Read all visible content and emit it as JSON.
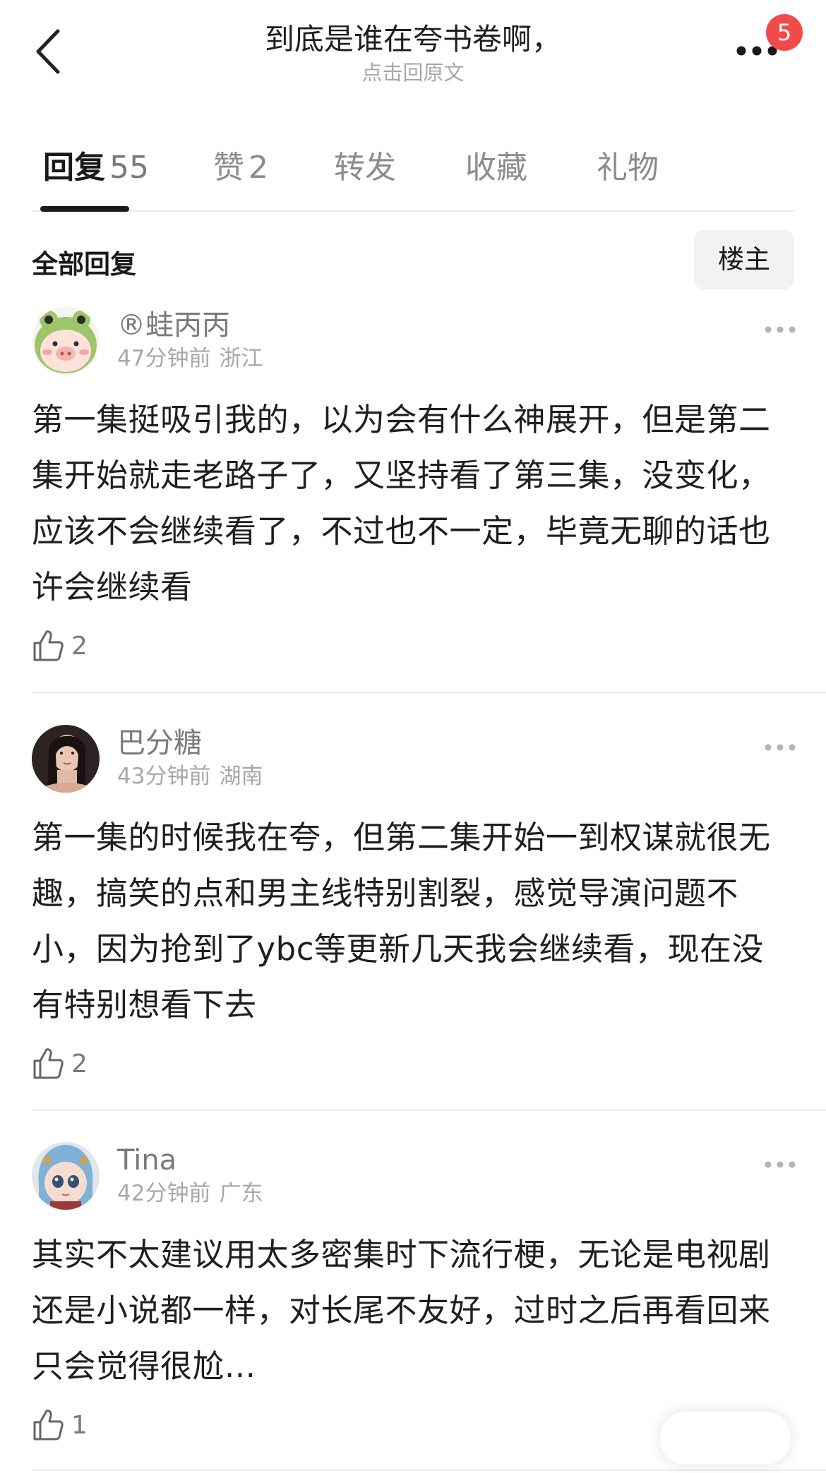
{
  "header": {
    "title": "到底是谁在夸书卷啊，",
    "subtitle": "点击回原文",
    "notification_count": "5"
  },
  "tabs": [
    {
      "label": "回复",
      "count": "55",
      "active": true
    },
    {
      "label": "赞",
      "count": "2",
      "active": false
    },
    {
      "label": "转发",
      "count": "",
      "active": false
    },
    {
      "label": "收藏",
      "count": "",
      "active": false
    },
    {
      "label": "礼物",
      "count": "",
      "active": false
    }
  ],
  "section": {
    "title": "全部回复",
    "filter_label": "楼主"
  },
  "comments": [
    {
      "username": "®蛙丙丙",
      "time": "47分钟前",
      "location": "浙江",
      "text": "第一集挺吸引我的，以为会有什么神展开，但是第二集开始就走老路子了，又坚持看了第三集，没变化，应该不会继续看了，不过也不一定，毕竟无聊的话也许会继续看",
      "likes": "2"
    },
    {
      "username": "巴分糖",
      "time": "43分钟前",
      "location": "湖南",
      "text": "第一集的时候我在夸，但第二集开始一到权谋就很无趣，搞笑的点和男主线特别割裂，感觉导演问题不小，因为抢到了ybc等更新几天我会继续看，现在没有特别想看下去",
      "likes": "2"
    },
    {
      "username": "Tina",
      "time": "42分钟前",
      "location": "广东",
      "text": "其实不太建议用太多密集时下流行梗，无论是电视剧还是小说都一样，对长尾不友好，过时之后再看回来只会觉得很尬...",
      "likes": "1"
    }
  ],
  "colors": {
    "badge": "#f24a4a",
    "text_primary": "#1a1a1a",
    "text_secondary": "#a8a8a8",
    "divider": "#ececec"
  }
}
